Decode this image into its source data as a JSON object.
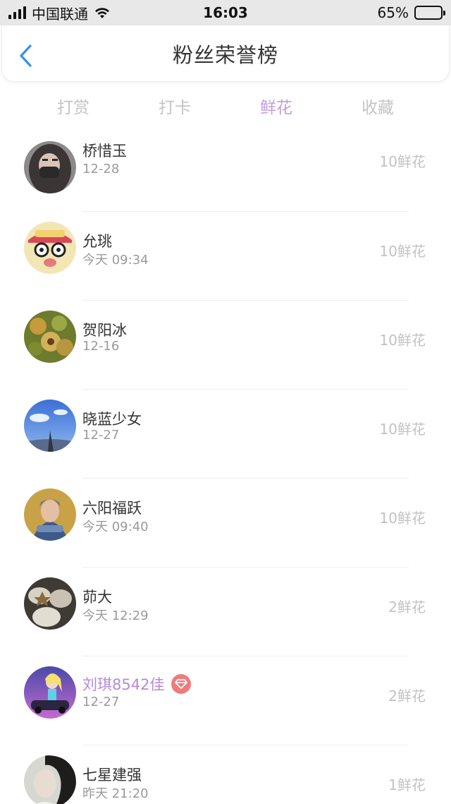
{
  "status_bar": {
    "carrier": "中国联通",
    "time": "16:03",
    "battery": "65%",
    "battery_level": 0.65
  },
  "header": {
    "title": "粉丝荣誉榜",
    "back_icon": "chevron-left-icon"
  },
  "tabs": [
    {
      "label": "打赏",
      "active": false
    },
    {
      "label": "打卡",
      "active": false
    },
    {
      "label": "鲜花",
      "active": true
    },
    {
      "label": "收藏",
      "active": false
    }
  ],
  "colors": {
    "accent": "#c39de0",
    "vip_name": "#b48ad9",
    "badge": "#f07b7b",
    "back": "#3d8fe0"
  },
  "fans": [
    {
      "name": "桥惜玉",
      "time": "12-28",
      "amount": "10鲜花",
      "vip": false,
      "avatar": "masked-girl-avatar"
    },
    {
      "name": "允珧",
      "time": "今天 09:34",
      "amount": "10鲜花",
      "vip": false,
      "avatar": "cartoon-kid-avatar"
    },
    {
      "name": "贺阳冰",
      "time": "12-16",
      "amount": "10鲜花",
      "vip": false,
      "avatar": "food-avatar"
    },
    {
      "name": "晓蓝少女",
      "time": "12-27",
      "amount": "10鲜花",
      "vip": false,
      "avatar": "blue-sky-avatar"
    },
    {
      "name": "六阳福跃",
      "time": "今天 09:40",
      "amount": "10鲜花",
      "vip": false,
      "avatar": "warrior-avatar"
    },
    {
      "name": "茆大",
      "time": "今天 12:29",
      "amount": "2鲜花",
      "vip": false,
      "avatar": "stones-avatar"
    },
    {
      "name": "刘琪8542佳",
      "time": "12-27",
      "amount": "2鲜花",
      "vip": true,
      "avatar": "anime-car-avatar"
    },
    {
      "name": "七星建强",
      "time": "昨天 21:20",
      "amount": "1鲜花",
      "vip": false,
      "avatar": "girl-photo-avatar"
    }
  ]
}
